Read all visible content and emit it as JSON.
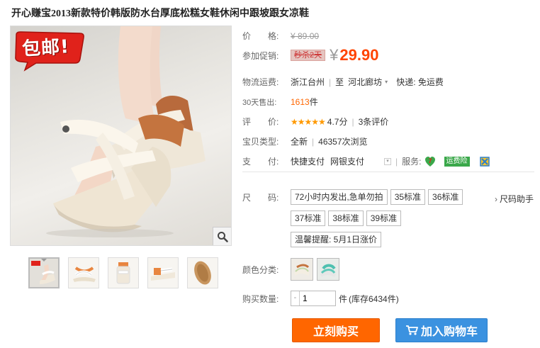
{
  "product": {
    "title": "开心赚宝2013新款特价韩版防水台厚底松糕女鞋休闲中跟坡跟女凉鞋",
    "badge_text": "包邮!"
  },
  "price": {
    "label": "价　　格:",
    "original": "¥ 89.00"
  },
  "promo": {
    "label": "参加促销:",
    "tag": "秒杀2天",
    "yen": "¥",
    "price": "29.90"
  },
  "shipping": {
    "label": "物流运费:",
    "from": "浙江台州",
    "to_prefix": "至",
    "to": "河北廊坊",
    "express": "快递: 免运费"
  },
  "sales": {
    "label": "30天售出:",
    "count": "1613",
    "unit": "件"
  },
  "rating": {
    "label": "评　　价:",
    "stars": "★★★★★",
    "score": "4.7分",
    "reviews": "3条评价"
  },
  "item_type": {
    "label": "宝贝类型:",
    "condition": "全新",
    "views": "46357次浏览"
  },
  "payment": {
    "label": "支　　付:",
    "methods": [
      "快捷支付",
      "网银支付"
    ],
    "service_label": "服务:",
    "freight_insurance": "运费险"
  },
  "size": {
    "label": "尺　　码:",
    "options": [
      "72小时内发出,急单勿拍",
      "35标准",
      "36标准",
      "37标准",
      "38标准",
      "39标准",
      "温馨提醒: 5月1日涨价"
    ],
    "help": "尺码助手"
  },
  "color": {
    "label": "颜色分类:"
  },
  "quantity": {
    "label": "购买数量:",
    "minus": "-",
    "value": "1",
    "unit": "件",
    "stock": "(库存6434件)"
  },
  "buttons": {
    "buy": "立刻购买",
    "cart": "加入购物车"
  },
  "colors": {
    "price_accent": "#ff4400",
    "buy_button": "#ff6600",
    "cart_button": "#3b92e0",
    "badge_red": "#e0221b"
  }
}
